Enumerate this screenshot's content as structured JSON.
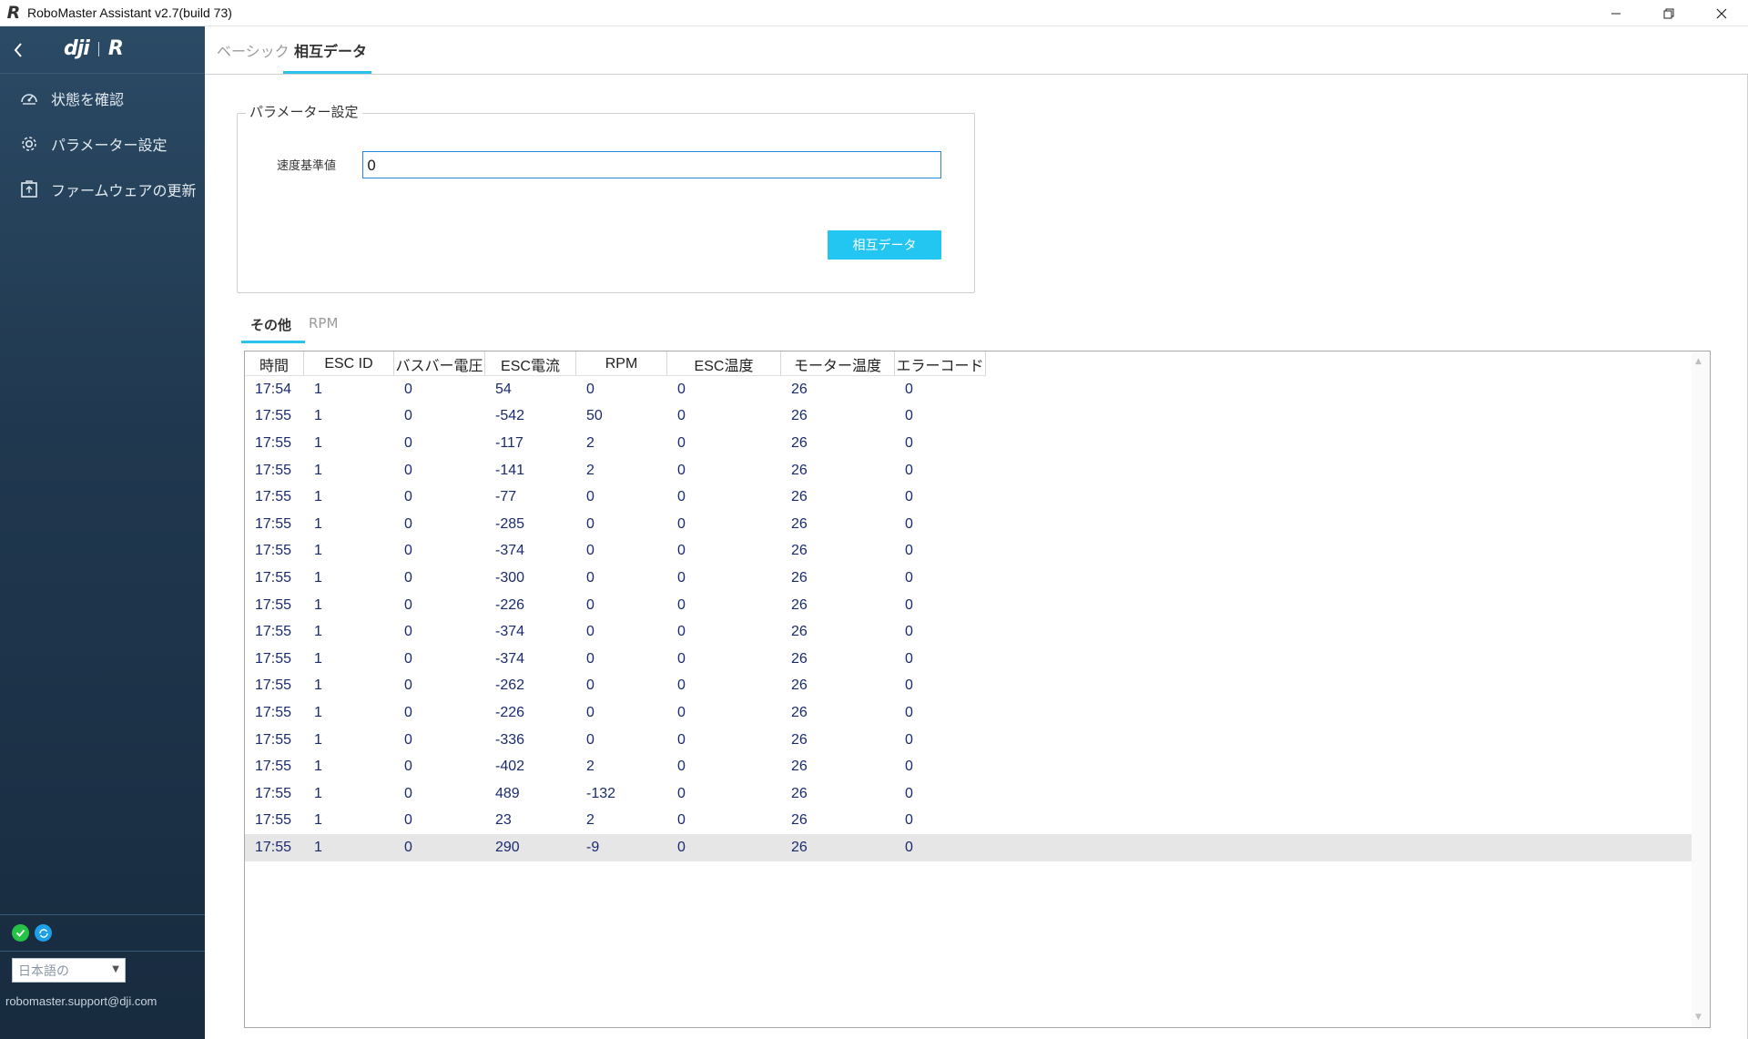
{
  "window": {
    "title": "RoboMaster Assistant v2.7(build 73)",
    "logo_letter": "R",
    "controls": [
      "minimize",
      "restore",
      "close"
    ]
  },
  "sidebar": {
    "brand_left": "dji",
    "brand_right": "R",
    "items": [
      {
        "label": "状態を確認",
        "icon": "gauge-icon"
      },
      {
        "label": "パラメーター設定",
        "icon": "gear-icon"
      },
      {
        "label": "ファームウェアの更新",
        "icon": "firmware-box-icon"
      }
    ],
    "language": "日本語の",
    "support_email": "robomaster.support@dji.com"
  },
  "top_tabs": {
    "basic": "ベーシック",
    "interactive": "相互データ"
  },
  "params": {
    "legend": "パラメーター設定",
    "speed_label": "速度基準値",
    "speed_value": "0",
    "button_label": "相互データ"
  },
  "sub_tabs": {
    "other": "その他",
    "rpm": "RPM"
  },
  "table": {
    "columns": [
      "時間",
      "ESC ID",
      "バスバー電圧",
      "ESC電流",
      "RPM",
      "ESC温度",
      "モーター温度",
      "エラーコード"
    ],
    "rows": [
      [
        "17:54",
        "1",
        "0",
        "54",
        "0",
        "0",
        "26",
        "0"
      ],
      [
        "17:55",
        "1",
        "0",
        "-542",
        "50",
        "0",
        "26",
        "0"
      ],
      [
        "17:55",
        "1",
        "0",
        "-117",
        "2",
        "0",
        "26",
        "0"
      ],
      [
        "17:55",
        "1",
        "0",
        "-141",
        "2",
        "0",
        "26",
        "0"
      ],
      [
        "17:55",
        "1",
        "0",
        "-77",
        "0",
        "0",
        "26",
        "0"
      ],
      [
        "17:55",
        "1",
        "0",
        "-285",
        "0",
        "0",
        "26",
        "0"
      ],
      [
        "17:55",
        "1",
        "0",
        "-374",
        "0",
        "0",
        "26",
        "0"
      ],
      [
        "17:55",
        "1",
        "0",
        "-300",
        "0",
        "0",
        "26",
        "0"
      ],
      [
        "17:55",
        "1",
        "0",
        "-226",
        "0",
        "0",
        "26",
        "0"
      ],
      [
        "17:55",
        "1",
        "0",
        "-374",
        "0",
        "0",
        "26",
        "0"
      ],
      [
        "17:55",
        "1",
        "0",
        "-374",
        "0",
        "0",
        "26",
        "0"
      ],
      [
        "17:55",
        "1",
        "0",
        "-262",
        "0",
        "0",
        "26",
        "0"
      ],
      [
        "17:55",
        "1",
        "0",
        "-226",
        "0",
        "0",
        "26",
        "0"
      ],
      [
        "17:55",
        "1",
        "0",
        "-336",
        "0",
        "0",
        "26",
        "0"
      ],
      [
        "17:55",
        "1",
        "0",
        "-402",
        "2",
        "0",
        "26",
        "0"
      ],
      [
        "17:55",
        "1",
        "0",
        "489",
        "-132",
        "0",
        "26",
        "0"
      ],
      [
        "17:55",
        "1",
        "0",
        "23",
        "2",
        "0",
        "26",
        "0"
      ],
      [
        "17:55",
        "1",
        "0",
        "290",
        "-9",
        "0",
        "26",
        "0"
      ]
    ],
    "selected_row": 17
  }
}
